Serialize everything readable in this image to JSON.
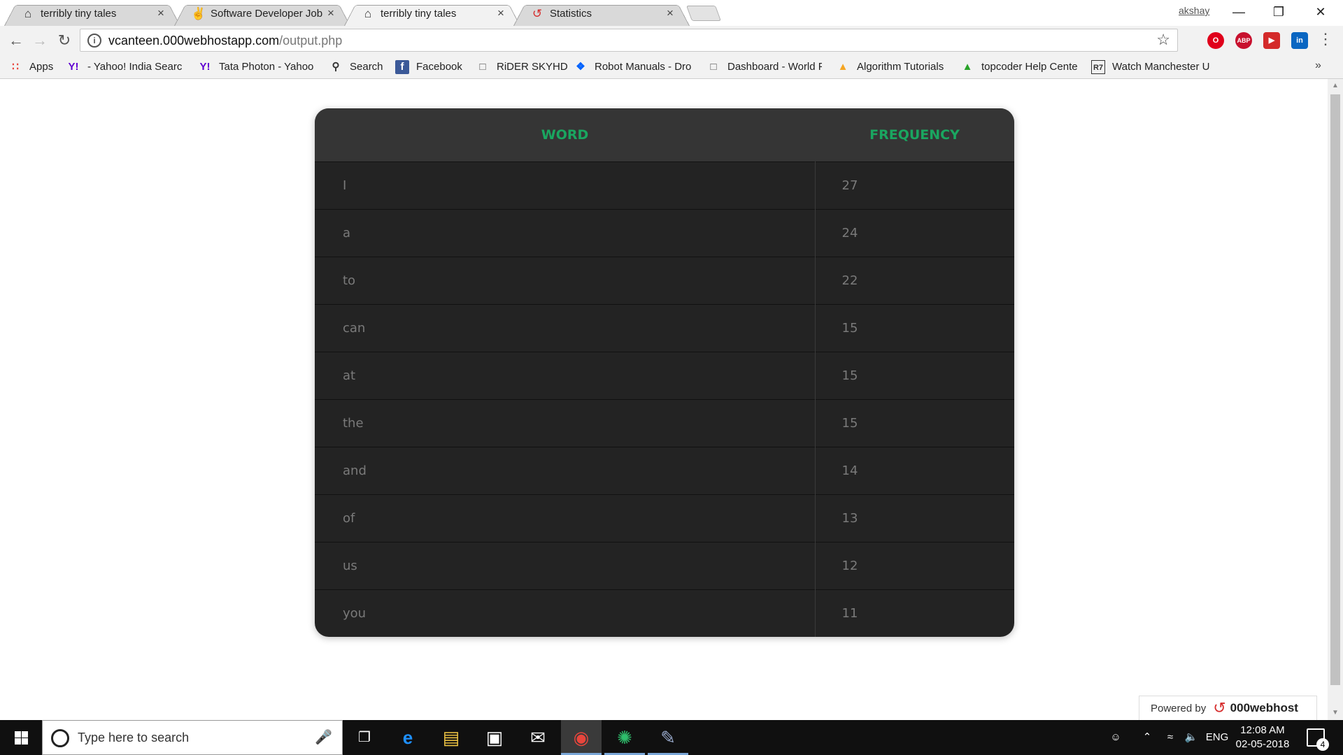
{
  "tabs": [
    {
      "title": "terribly tiny tales",
      "icon": "home-icon",
      "active": false
    },
    {
      "title": "Software Developer Job a",
      "icon": "peace-hand-icon",
      "active": false
    },
    {
      "title": "terribly tiny tales",
      "icon": "home-icon",
      "active": true
    },
    {
      "title": "Statistics",
      "icon": "000webhost-icon",
      "active": false
    }
  ],
  "window": {
    "profile_name": "akshay"
  },
  "address_bar": {
    "url_host": "vcanteen.000webhostapp.com",
    "url_path": "/output.php"
  },
  "bookmarks": [
    {
      "label": "Apps",
      "icon": "apps-grid-icon"
    },
    {
      "label": "- Yahoo! India Searc",
      "icon": "yahoo-icon"
    },
    {
      "label": "Tata Photon - Yahoo",
      "icon": "yahoo-icon"
    },
    {
      "label": "Search",
      "icon": "search-icon"
    },
    {
      "label": "Facebook",
      "icon": "facebook-icon"
    },
    {
      "label": "RiDER SKYHD",
      "icon": "page-icon"
    },
    {
      "label": "Robot Manuals - Dro",
      "icon": "dropbox-icon"
    },
    {
      "label": "Dashboard - World F",
      "icon": "page-icon"
    },
    {
      "label": "Algorithm Tutorials",
      "icon": "topcoder-icon"
    },
    {
      "label": "topcoder Help Cente",
      "icon": "topcoder-icon"
    },
    {
      "label": "Watch Manchester U",
      "icon": "r7-icon"
    }
  ],
  "table": {
    "headers": {
      "word": "WORD",
      "frequency": "FREQUENCY"
    },
    "rows": [
      {
        "word": "I",
        "frequency": "27"
      },
      {
        "word": "a",
        "frequency": "24"
      },
      {
        "word": "to",
        "frequency": "22"
      },
      {
        "word": "can",
        "frequency": "15"
      },
      {
        "word": "at",
        "frequency": "15"
      },
      {
        "word": "the",
        "frequency": "15"
      },
      {
        "word": "and",
        "frequency": "14"
      },
      {
        "word": "of",
        "frequency": "13"
      },
      {
        "word": "us",
        "frequency": "12"
      },
      {
        "word": "you",
        "frequency": "11"
      }
    ],
    "colors": {
      "header_text": "#1aa660",
      "header_bg": "#353535",
      "body_bg": "#232323",
      "cell_text": "#7a7a7a"
    }
  },
  "powered_badge": {
    "prefix": "Powered by",
    "brand": "000webhost"
  },
  "taskbar": {
    "search_placeholder": "Type here to search",
    "language": "ENG",
    "time": "12:08 AM",
    "date": "02-05-2018",
    "notification_count": "4"
  }
}
